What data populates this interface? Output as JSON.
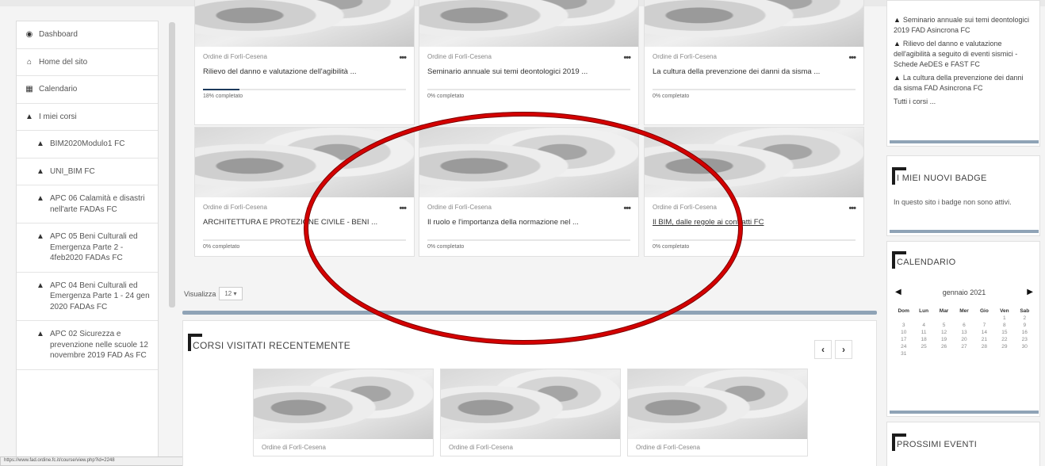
{
  "nav": {
    "items": [
      {
        "icon": "tachometer-icon",
        "glyph": "◉",
        "label": "Dashboard",
        "sub": false
      },
      {
        "icon": "home-icon",
        "glyph": "⌂",
        "label": "Home del sito",
        "sub": false
      },
      {
        "icon": "calendar-icon",
        "glyph": "▦",
        "label": "Calendario",
        "sub": false
      },
      {
        "icon": "graduation-cap-icon",
        "glyph": "▲",
        "label": "I miei corsi",
        "sub": false
      },
      {
        "icon": "graduation-cap-icon",
        "glyph": "▲",
        "label": "BIM2020Modulo1 FC",
        "sub": true
      },
      {
        "icon": "graduation-cap-icon",
        "glyph": "▲",
        "label": "UNI_BIM FC",
        "sub": true
      },
      {
        "icon": "graduation-cap-icon",
        "glyph": "▲",
        "label": "APC 06 Calamità e disastri nell'arte FADAs FC",
        "sub": true
      },
      {
        "icon": "graduation-cap-icon",
        "glyph": "▲",
        "label": "APC 05 Beni Culturali ed Emergenza Parte 2 - 4feb2020 FADAs FC",
        "sub": true
      },
      {
        "icon": "graduation-cap-icon",
        "glyph": "▲",
        "label": "APC 04 Beni Culturali ed Emergenza Parte 1 - 24 gen 2020 FADAs FC",
        "sub": true
      },
      {
        "icon": "graduation-cap-icon",
        "glyph": "▲",
        "label": "APC 02 Sicurezza e prevenzione nelle scuole 12 novembre 2019 FAD As FC",
        "sub": true
      }
    ]
  },
  "status_url": "https://www.fad.ordine.fc.it/course/view.php?id=2248",
  "courses": [
    {
      "org": "Ordine di Forlì-Cesena",
      "title": "Rilievo del danno e valutazione dell'agibilità ...",
      "progress_pct": 18,
      "progress_text": "18% completato"
    },
    {
      "org": "Ordine di Forlì-Cesena",
      "title": "Seminario annuale sui temi deontologici 2019 ...",
      "progress_pct": 0,
      "progress_text": "0% completato"
    },
    {
      "org": "Ordine di Forlì-Cesena",
      "title": "La cultura della prevenzione dei danni da sisma ...",
      "progress_pct": 0,
      "progress_text": "0% completato"
    },
    {
      "org": "Ordine di Forlì-Cesena",
      "title": "ARCHITETTURA E PROTEZIONE CIVILE - BENI ...",
      "progress_pct": 0,
      "progress_text": "0% completato"
    },
    {
      "org": "Ordine di Forlì-Cesena",
      "title": "Il ruolo e l'importanza della normazione nel ...",
      "progress_pct": 0,
      "progress_text": "0% completato"
    },
    {
      "org": "Ordine di Forlì-Cesena",
      "title": "Il BIM, dalle regole ai contratti FC",
      "progress_pct": 0,
      "progress_text": "0% completato"
    }
  ],
  "more_label": "•••",
  "visualizza": {
    "label": "Visualizza",
    "value": "12 ▾"
  },
  "recent": {
    "title": "CORSI VISITATI RECENTEMENTE",
    "prev": "‹",
    "next": "›",
    "cards": [
      {
        "org": "Ordine di Forlì-Cesena"
      },
      {
        "org": "Ordine di Forlì-Cesena"
      },
      {
        "org": "Ordine di Forlì-Cesena"
      }
    ]
  },
  "right": {
    "course_links": [
      "Seminario annuale sui temi deontologici 2019 FAD Asincrona FC",
      "Rilievo del danno e valutazione dell'agibilità a seguito di eventi sismici - Schede AeDES e FAST FC",
      "La cultura della prevenzione dei danni da sisma FAD Asincrona FC"
    ],
    "all_courses": "Tutti i corsi ...",
    "badges_title": "I MIEI NUOVI BADGE",
    "badges_text": "In questo sito i badge non sono attivi.",
    "calendar_title": "CALENDARIO",
    "calendar_month": "gennaio 2021",
    "cal_prev": "◀",
    "cal_next": "▶",
    "weekdays": [
      "Dom",
      "Lun",
      "Mar",
      "Mer",
      "Gio",
      "Ven",
      "Sab"
    ],
    "days": [
      "",
      "",
      "",
      "",
      "",
      "1",
      "2",
      "3",
      "4",
      "5",
      "6",
      "7",
      "8",
      "9",
      "10",
      "11",
      "12",
      "13",
      "14",
      "15",
      "16",
      "17",
      "18",
      "19",
      "20",
      "21",
      "22",
      "23",
      "24",
      "25",
      "26",
      "27",
      "28",
      "29",
      "30",
      "31",
      "",
      "",
      "",
      "",
      "",
      ""
    ],
    "events_title": "PROSSIMI EVENTI"
  },
  "colors": {
    "annotation": "#d40000",
    "accent": "#8fa3b6",
    "progress": "#1d3a5c"
  }
}
